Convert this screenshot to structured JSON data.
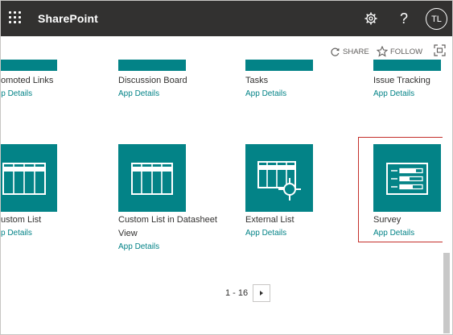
{
  "suite": {
    "brand": "SharePoint",
    "avatar_initials": "TL",
    "help_glyph": "?"
  },
  "commands": {
    "share_label": "SHARE",
    "follow_label": "FOLLOW"
  },
  "apps": [
    {
      "title": "omoted Links",
      "details": "App Details"
    },
    {
      "title": "Discussion Board",
      "details": "App Details"
    },
    {
      "title": "Tasks",
      "details": "App Details"
    },
    {
      "title": "Issue Tracking",
      "details": "App Details"
    },
    {
      "title": "ustom List",
      "details": "p Details"
    },
    {
      "title": "Custom List in Datasheet View",
      "details": "App Details"
    },
    {
      "title": "External List",
      "details": "App Details"
    },
    {
      "title": "Survey",
      "details": "App Details"
    }
  ],
  "pager": {
    "range": "1 - 16"
  },
  "colors": {
    "suite_bar": "#323130",
    "tile": "#038387",
    "selection": "#c4302b"
  }
}
